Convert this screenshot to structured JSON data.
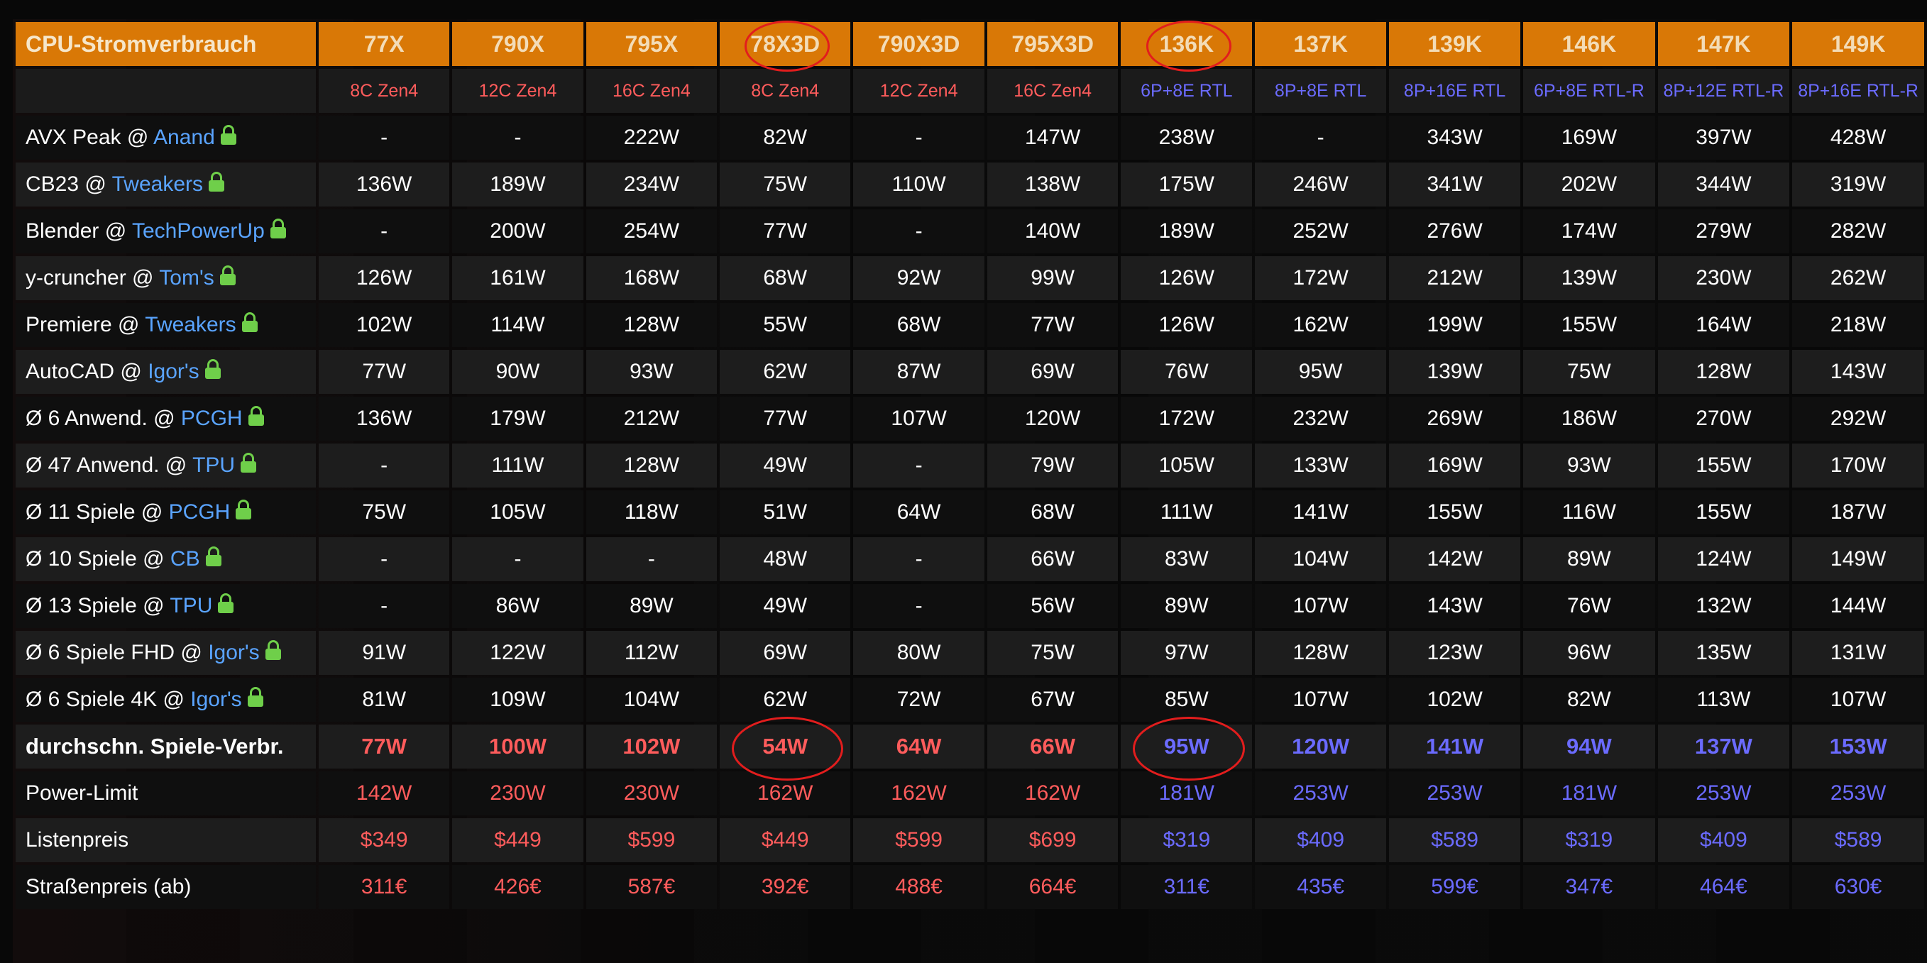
{
  "table": {
    "corner_title": "CPU-Stromverbrauch",
    "columns": [
      "77X",
      "790X",
      "795X",
      "78X3D",
      "790X3D",
      "795X3D",
      "136K",
      "137K",
      "139K",
      "146K",
      "147K",
      "149K"
    ],
    "vendors": [
      "amd",
      "amd",
      "amd",
      "amd",
      "amd",
      "amd",
      "intel",
      "intel",
      "intel",
      "intel",
      "intel",
      "intel"
    ],
    "specs": [
      "8C Zen4",
      "12C Zen4",
      "16C Zen4",
      "8C Zen4",
      "12C Zen4",
      "16C Zen4",
      "6P+8E RTL",
      "8P+8E RTL",
      "8P+16E RTL",
      "6P+8E RTL-R",
      "8P+12E RTL-R",
      "8P+16E RTL-R"
    ],
    "highlighted_columns": [
      "78X3D",
      "136K"
    ],
    "rows": [
      {
        "label": "AVX Peak @ ",
        "source": "Anand",
        "lock": true,
        "values": [
          "-",
          "-",
          "222W",
          "82W",
          "-",
          "147W",
          "238W",
          "-",
          "343W",
          "169W",
          "397W",
          "428W"
        ]
      },
      {
        "label": "CB23 @ ",
        "source": "Tweakers",
        "lock": true,
        "values": [
          "136W",
          "189W",
          "234W",
          "75W",
          "110W",
          "138W",
          "175W",
          "246W",
          "341W",
          "202W",
          "344W",
          "319W"
        ]
      },
      {
        "label": "Blender @ ",
        "source": "TechPowerUp",
        "lock": true,
        "values": [
          "-",
          "200W",
          "254W",
          "77W",
          "-",
          "140W",
          "189W",
          "252W",
          "276W",
          "174W",
          "279W",
          "282W"
        ]
      },
      {
        "label": "y-cruncher @ ",
        "source": "Tom's",
        "lock": true,
        "values": [
          "126W",
          "161W",
          "168W",
          "68W",
          "92W",
          "99W",
          "126W",
          "172W",
          "212W",
          "139W",
          "230W",
          "262W"
        ]
      },
      {
        "label": "Premiere @ ",
        "source": "Tweakers",
        "lock": true,
        "values": [
          "102W",
          "114W",
          "128W",
          "55W",
          "68W",
          "77W",
          "126W",
          "162W",
          "199W",
          "155W",
          "164W",
          "218W"
        ]
      },
      {
        "label": "AutoCAD @ ",
        "source": "Igor's",
        "lock": true,
        "values": [
          "77W",
          "90W",
          "93W",
          "62W",
          "87W",
          "69W",
          "76W",
          "95W",
          "139W",
          "75W",
          "128W",
          "143W"
        ]
      },
      {
        "label": "Ø 6 Anwend. @ ",
        "source": "PCGH",
        "lock": true,
        "values": [
          "136W",
          "179W",
          "212W",
          "77W",
          "107W",
          "120W",
          "172W",
          "232W",
          "269W",
          "186W",
          "270W",
          "292W"
        ]
      },
      {
        "label": "Ø 47 Anwend. @ ",
        "source": "TPU",
        "lock": true,
        "values": [
          "-",
          "111W",
          "128W",
          "49W",
          "-",
          "79W",
          "105W",
          "133W",
          "169W",
          "93W",
          "155W",
          "170W"
        ]
      },
      {
        "label": "Ø 11 Spiele @ ",
        "source": "PCGH",
        "lock": true,
        "values": [
          "75W",
          "105W",
          "118W",
          "51W",
          "64W",
          "68W",
          "111W",
          "141W",
          "155W",
          "116W",
          "155W",
          "187W"
        ]
      },
      {
        "label": "Ø 10 Spiele @ ",
        "source": "CB",
        "lock": true,
        "values": [
          "-",
          "-",
          "-",
          "48W",
          "-",
          "66W",
          "83W",
          "104W",
          "142W",
          "89W",
          "124W",
          "149W"
        ]
      },
      {
        "label": "Ø 13 Spiele @ ",
        "source": "TPU",
        "lock": true,
        "values": [
          "-",
          "86W",
          "89W",
          "49W",
          "-",
          "56W",
          "89W",
          "107W",
          "143W",
          "76W",
          "132W",
          "144W"
        ]
      },
      {
        "label": "Ø 6 Spiele FHD @ ",
        "source": "Igor's",
        "lock": true,
        "values": [
          "91W",
          "122W",
          "112W",
          "69W",
          "80W",
          "75W",
          "97W",
          "128W",
          "123W",
          "96W",
          "135W",
          "131W"
        ]
      },
      {
        "label": "Ø 6 Spiele 4K @ ",
        "source": "Igor's",
        "lock": true,
        "values": [
          "81W",
          "109W",
          "104W",
          "62W",
          "72W",
          "67W",
          "85W",
          "107W",
          "102W",
          "82W",
          "113W",
          "107W"
        ]
      },
      {
        "label": "durchschn. Spiele-Verbr.",
        "source": "",
        "lock": false,
        "summary": true,
        "colored": true,
        "values": [
          "77W",
          "100W",
          "102W",
          "54W",
          "64W",
          "66W",
          "95W",
          "120W",
          "141W",
          "94W",
          "137W",
          "153W"
        ]
      },
      {
        "label": "Power-Limit",
        "source": "",
        "lock": false,
        "colored": true,
        "values": [
          "142W",
          "230W",
          "230W",
          "162W",
          "162W",
          "162W",
          "181W",
          "253W",
          "253W",
          "181W",
          "253W",
          "253W"
        ]
      },
      {
        "label": "Listenpreis",
        "source": "",
        "lock": false,
        "colored": true,
        "values": [
          "$349",
          "$449",
          "$599",
          "$449",
          "$599",
          "$699",
          "$319",
          "$409",
          "$589",
          "$319",
          "$409",
          "$589"
        ]
      },
      {
        "label": "Straßenpreis (ab)",
        "source": "",
        "lock": false,
        "colored": true,
        "values": [
          "311€",
          "426€",
          "587€",
          "392€",
          "488€",
          "664€",
          "311€",
          "435€",
          "599€",
          "347€",
          "464€",
          "630€"
        ]
      }
    ]
  },
  "colors": {
    "header_orange": "#d97806",
    "amd_red": "#ff5c5c",
    "intel_blue": "#6b6bff",
    "source_link": "#5aa4ff",
    "lock_green": "#6fcf4a",
    "highlight_ring": "#e21d1d"
  }
}
